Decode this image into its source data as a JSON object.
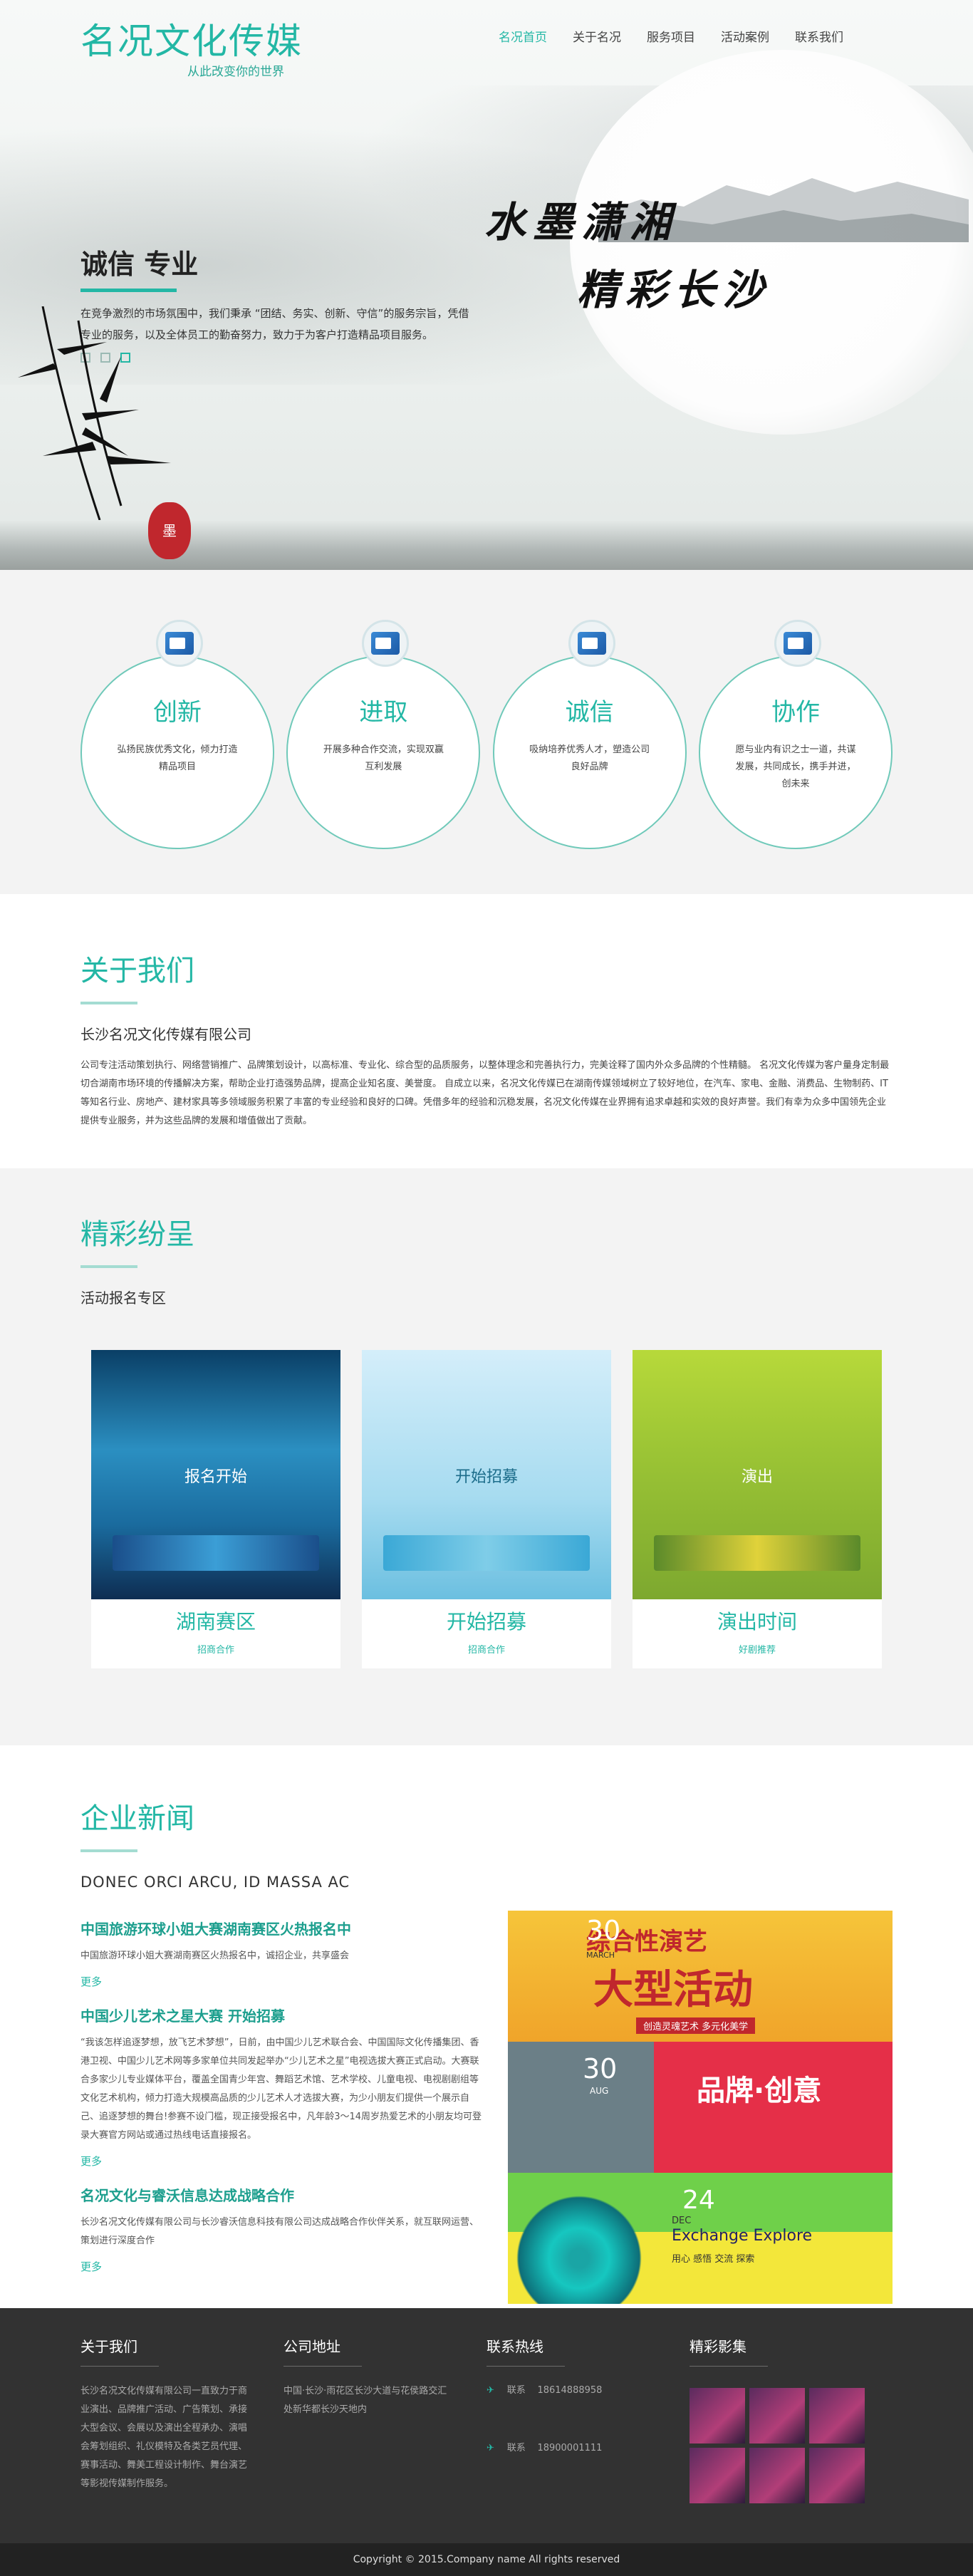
{
  "header": {
    "brand": "名况文化传媒",
    "tagline": "从此改变你的世界",
    "nav": [
      "名况首页",
      "关于名况",
      "服务项目",
      "活动案例",
      "联系我们"
    ]
  },
  "hero": {
    "calligraphy_1": "水墨潇湘",
    "calligraphy_2": "精彩长沙",
    "title": "诚信 专业",
    "text": "在竞争激烈的市场氛围中，我们秉承 “团结、务实、创新、守信”的服务宗旨，凭借专业的服务，以及全体员工的勤奋努力，致力于为客户打造精品项目服务。",
    "seal": "墨"
  },
  "features": [
    {
      "title": "创新",
      "desc": "弘扬民族优秀文化，倾力打造精品项目"
    },
    {
      "title": "进取",
      "desc": "开展多种合作交流，实现双赢互利发展"
    },
    {
      "title": "诚信",
      "desc": "吸纳培养优秀人才，塑造公司良好品牌"
    },
    {
      "title": "协作",
      "desc": "愿与业内有识之士一道，共谋发展，共同成长，携手并进，创未来"
    }
  ],
  "about": {
    "title": "关于我们",
    "subtitle": "长沙名况文化传媒有限公司",
    "text": "公司专注活动策划执行、网络营销推广、品牌策划设计，以高标准、专业化、综合型的品质服务，以整体理念和完善执行力，完美诠释了国内外众多品牌的个性精髓。 名况文化传媒为客户量身定制最切合湖南市场环境的传播解决方案，帮助企业打造强势品牌，提高企业知名度、美誉度。 自成立以来，名况文化传媒已在湖南传媒领域树立了较好地位，在汽车、家电、金融、消费品、生物制药、IT 等知名行业、房地产、建材家具等多领域服务积累了丰富的专业经验和良好的口碑。凭借多年的经验和沉稳发展，名况文化传媒在业界拥有追求卓越和实效的良好声誉。我们有幸为众多中国领先企业提供专业服务，并为这些品牌的发展和增值做出了贡献。"
  },
  "gallery": {
    "title": "精彩纷呈",
    "subtitle": "活动报名专区",
    "cards": [
      {
        "title": "湖南赛区",
        "overlay": "报名开始",
        "more": "招商合作"
      },
      {
        "title": "开始招募",
        "overlay": "开始招募",
        "more": "招商合作"
      },
      {
        "title": "演出时间",
        "overlay": "演出",
        "more": "好剧推荐"
      }
    ]
  },
  "news": {
    "title": "企业新闻",
    "subtitle": "DONEC ORCI ARCU, ID MASSA AC",
    "items": [
      {
        "title": "中国旅游环球小姐大赛湖南赛区火热报名中",
        "text": "中国旅游环球小姐大赛湖南赛区火热报名中，诚招企业，共享盛会",
        "more": "更多"
      },
      {
        "title": "中国少儿艺术之星大赛 开始招募",
        "text": "“我该怎样追逐梦想，放飞艺术梦想”，日前，由中国少儿艺术联合会、中国国际文化传播集团、香港卫视、中国少儿艺术网等多家单位共同发起举办“少儿艺术之星”电视选拔大赛正式启动。大赛联合多家少儿专业媒体平台，覆盖全国青少年宫、舞蹈艺术馆、艺术学校、儿童电视、电视剧剧组等文化艺术机构，倾力打造大规模高品质的少儿艺术人才选拔大赛，为少小朋友们提供一个展示自己、追逐梦想的舞台!参赛不设门槛，现正接受报名中，凡年龄3～14周岁热爱艺术的小朋友均可登录大赛官方网站或通过热线电话直接报名。",
        "more": "更多"
      },
      {
        "title": "名况文化与睿沃信息达成战略合作",
        "text": "长沙名况文化传媒有限公司与长沙睿沃信息科技有限公司达成战略合作伙伴关系，就互联网运营、策划进行深度合作",
        "more": "更多"
      }
    ],
    "poster": {
      "big_1": "综合性演艺",
      "big_2": "大型活动",
      "caption_1": "创造灵魂艺术 多元化美学",
      "num_1": "30",
      "mon_1": "MARCH",
      "num_2": "30",
      "mon_2": "AUG",
      "brand_big": "品牌·创意",
      "num_3": "24",
      "mon_3": "DEC",
      "exchange": "Exchange Explore",
      "caption_3": "用心 感悟 交流 探索"
    }
  },
  "footer": {
    "about_title": "关于我们",
    "about_text": "长沙名况文化传媒有限公司一直致力于商业演出、品牌推广活动、广告策划、承接大型会议、会展以及演出全程承办、演唱会筹划组织、礼仪模特及各类艺员代理、赛事活动、舞美工程设计制作、舞台演艺等影视传媒制作服务。",
    "addr_title": "公司地址",
    "addr_text": "中国·长沙·雨花区长沙大道与花侯路交汇处新华都长沙天地内",
    "tel_title": "联系热线",
    "tel_label": "联系",
    "tel_1": "18614888958",
    "tel_2": "18900001111",
    "gallery_title": "精彩影集",
    "copyright": "Copyright © 2015.Company name All rights reserved"
  },
  "colors": {
    "accent": "#23b7a5",
    "footer": "#323232"
  }
}
